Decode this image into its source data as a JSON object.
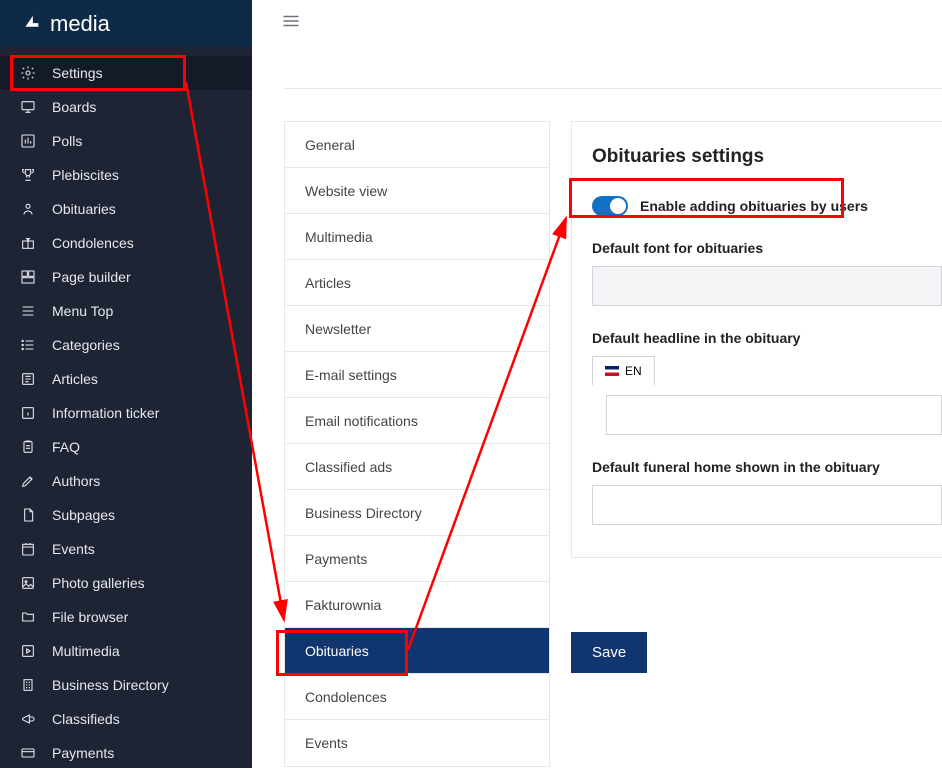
{
  "brand": {
    "name": "media"
  },
  "sidebar": {
    "items": [
      {
        "label": "Settings"
      },
      {
        "label": "Boards"
      },
      {
        "label": "Polls"
      },
      {
        "label": "Plebiscites"
      },
      {
        "label": "Obituaries"
      },
      {
        "label": "Condolences"
      },
      {
        "label": "Page builder"
      },
      {
        "label": "Menu Top"
      },
      {
        "label": "Categories"
      },
      {
        "label": "Articles"
      },
      {
        "label": "Information ticker"
      },
      {
        "label": "FAQ"
      },
      {
        "label": "Authors"
      },
      {
        "label": "Subpages"
      },
      {
        "label": "Events"
      },
      {
        "label": "Photo galleries"
      },
      {
        "label": "File browser"
      },
      {
        "label": "Multimedia"
      },
      {
        "label": "Business Directory"
      },
      {
        "label": "Classifieds"
      },
      {
        "label": "Payments"
      }
    ]
  },
  "submenu": {
    "items": [
      "General",
      "Website view",
      "Multimedia",
      "Articles",
      "Newsletter",
      "E-mail settings",
      "Email notifications",
      "Classified ads",
      "Business Directory",
      "Payments",
      "Fakturownia",
      "Obituaries",
      "Condolences",
      "Events"
    ],
    "active_index": 11
  },
  "panel": {
    "title": "Obituaries settings",
    "toggle_label": "Enable adding obituaries by users",
    "font_label": "Default font for obituaries",
    "headline_label": "Default headline in the obituary",
    "lang_tab": "EN",
    "funeral_label": "Default funeral home shown in the obituary"
  },
  "actions": {
    "save": "Save"
  }
}
